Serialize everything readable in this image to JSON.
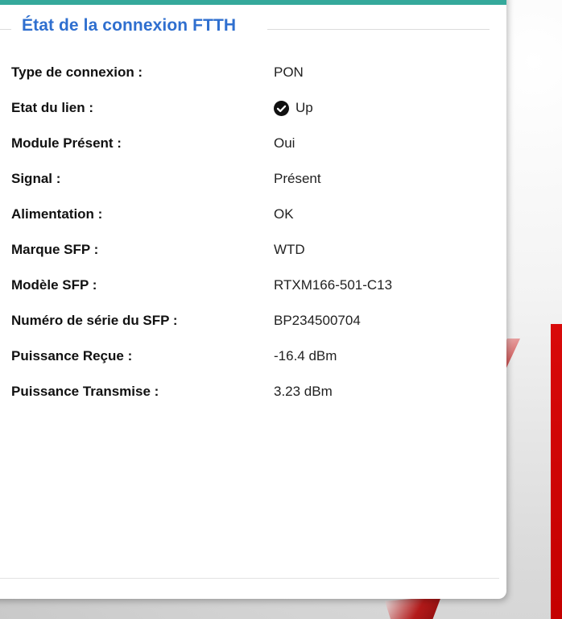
{
  "section": {
    "title": "État de la connexion FTTH"
  },
  "rows": [
    {
      "label": "Type de connexion :",
      "value": "PON"
    },
    {
      "label": "Etat du lien :",
      "value": "Up",
      "icon": "check-circle-icon"
    },
    {
      "label": "Module Présent :",
      "value": "Oui"
    },
    {
      "label": "Signal :",
      "value": "Présent"
    },
    {
      "label": "Alimentation :",
      "value": "OK"
    },
    {
      "label": "Marque SFP :",
      "value": "WTD"
    },
    {
      "label": "Modèle SFP :",
      "value": "RTXM166-501-C13"
    },
    {
      "label": "Numéro de série du SFP :",
      "value": "BP234500704"
    },
    {
      "label": "Puissance Reçue :",
      "value": "-16.4 dBm"
    },
    {
      "label": "Puissance Transmise :",
      "value": "3.23 dBm"
    }
  ],
  "colors": {
    "accent_bar": "#35a99b",
    "title": "#2f6fcf",
    "background_red": "#c40000"
  }
}
